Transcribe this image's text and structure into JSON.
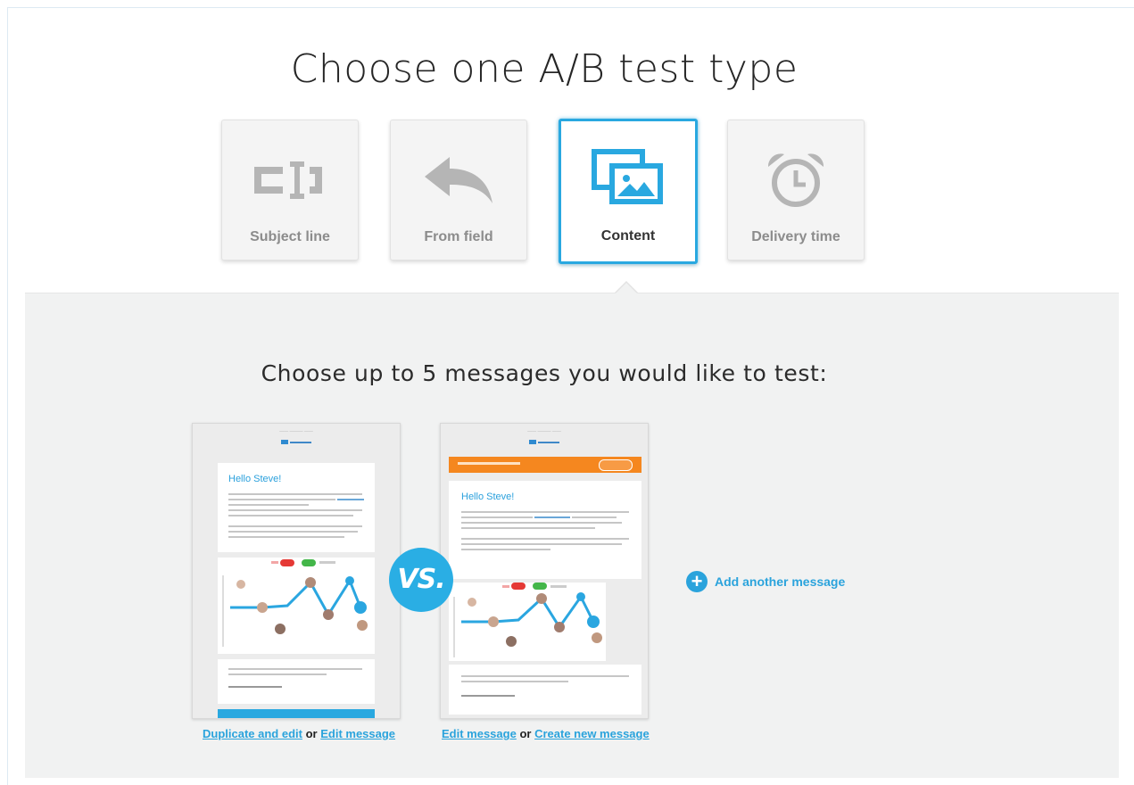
{
  "page": {
    "title": "Choose one A/B test type",
    "subtitle": "Choose up to 5 messages you would like to test:"
  },
  "test_types": [
    {
      "label": "Subject line",
      "icon": "text-cursor-icon",
      "selected": false
    },
    {
      "label": "From field",
      "icon": "reply-arrow-icon",
      "selected": false
    },
    {
      "label": "Content",
      "icon": "images-icon",
      "selected": true
    },
    {
      "label": "Delivery time",
      "icon": "alarm-clock-icon",
      "selected": false
    }
  ],
  "messages": [
    {
      "preview_greeting": "Hello Steve!",
      "actions": {
        "primary": "Duplicate and edit",
        "separator": "or",
        "secondary": "Edit message"
      }
    },
    {
      "preview_greeting": "Hello Steve!",
      "actions": {
        "primary": "Edit message",
        "separator": "or",
        "secondary": "Create new message"
      }
    }
  ],
  "vs_label": "VS.",
  "add_message": {
    "label": "Add another message",
    "icon": "plus-circle-icon"
  },
  "colors": {
    "accent": "#29a8e0",
    "orange": "#f5871f",
    "panel_bg": "#f1f2f2",
    "icon_gray": "#b5b5b5"
  }
}
